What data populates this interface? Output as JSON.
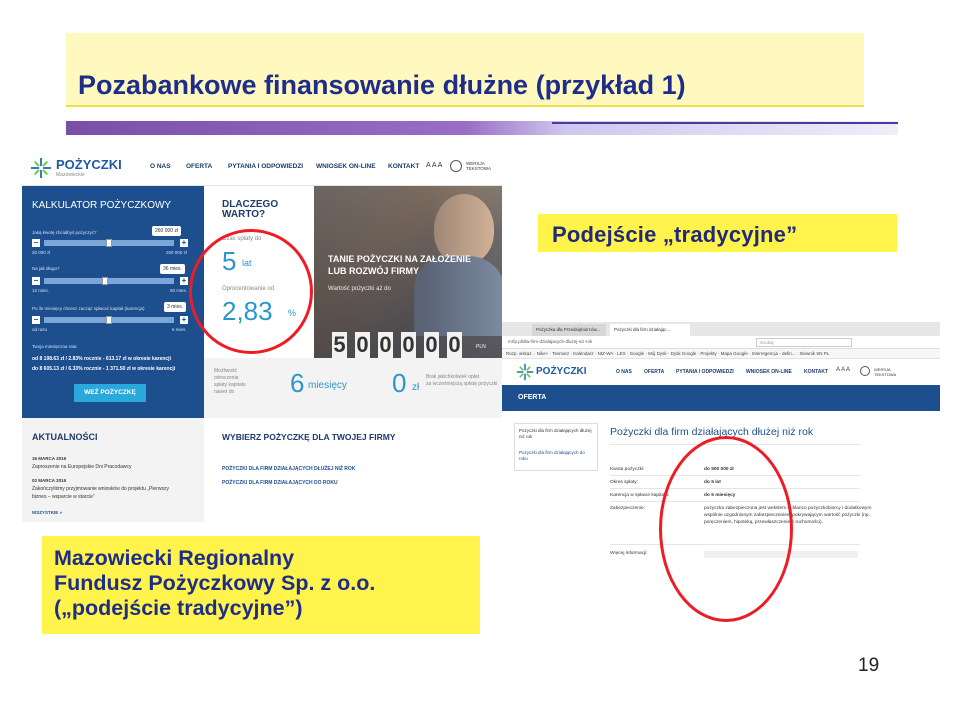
{
  "slide": {
    "title": "Pozabankowe finansowanie dłużne (przykład 1)",
    "label_traditional": "Podejście „tradycyjne”",
    "caption_line1": "Mazowiecki Regionalny",
    "caption_line2": "Fundusz Pożyczkowy Sp. z o.o.",
    "caption_line3": "(„podejście tradycyjne”)",
    "page_number": "19",
    "colors": {
      "title_bg": "#fff9bf",
      "highlight": "#fff34c",
      "text_blue": "#1f2d8a",
      "circle_red": "#ee1c24"
    }
  },
  "website": {
    "logo": "POŻYCZKI",
    "logo_sub": "Mazowieckie",
    "nav": [
      "O NAS",
      "OFERTA",
      "PYTANIA I ODPOWIEDZI",
      "WNIOSEK ON-LINE",
      "KONTAKT"
    ],
    "font_size_control": "A A A",
    "contrast_label": "WERSJA TEKSTOWA",
    "calculator": {
      "title": "KALKULATOR POŻYCZKOWY",
      "q1": "Jaką kwotę chciałbyś pożyczyć?",
      "q1_value": "260 000 zł",
      "q1_min": "20 000 zł",
      "q1_max": "200 000 zł",
      "q2": "Na jak długo?",
      "q2_value": "36 mies.",
      "q2_min": "12 mies.",
      "q2_max": "60 mies.",
      "q3": "Po ile miesięcy chcesz zacząć spłacać kapitał (karencja)",
      "q3_value": "3 mies.",
      "q3_min": "od razu",
      "q3_max": "6 mies.",
      "rate_label": "Twoja miesięczna rata",
      "rate1": "od 8 198.63 zł / 2.83% rocznie - 613.17 zł w okresie karencji",
      "rate2": "do 8 605.13 zł / 6.33% rocznie - 1 371.50 zł w okresie karencji",
      "button": "WEŹ POŻYCZKĘ"
    },
    "why": {
      "title_line1": "DLACZEGO",
      "title_line2": "WARTO?",
      "term_label": "Czas spłaty do",
      "term_value": "5",
      "term_unit": "lat",
      "rate_label": "Oprocentowanie od",
      "rate_value": "2,83",
      "rate_unit": "%"
    },
    "hero": {
      "title_line1": "TANIE POŻYCZKI NA ZAŁOŻENIE",
      "title_line2": "LUB ROZWÓJ FIRMY",
      "sub": "Wartość pożyczki aż do",
      "digits": [
        "5",
        "0",
        "0",
        "0",
        "0",
        "0"
      ],
      "currency": "PLN"
    },
    "benefits": {
      "grace_text_1": "Możliwość",
      "grace_text_2": "odroczenia",
      "grace_text_3": "spłaty kapitału",
      "grace_text_4": "nawet do",
      "grace_value": "6",
      "grace_unit": "miesięcy",
      "fee_value": "0",
      "fee_unit": "zł",
      "fee_text_1": "Brak jakichkolwiek opłat",
      "fee_text_2": "za wcześniejszą spłatę pożyczki"
    },
    "news": {
      "title": "AKTUALNOŚCI",
      "date1": "16 MARCA 2016",
      "text1": "Zaproszenie na Europejskie Dni Pracodawcy",
      "date2": "02 MARCA 2016",
      "text2a": "Zakończyliśmy przyjmowanie wniosków do projektu „Pierwszy",
      "text2b": "biznes – wsparcie w starcie”",
      "more": "WSZYSTKIE »"
    },
    "choose": {
      "title": "WYBIERZ POŻYCZKĘ DLA TWOJEJ FIRMY",
      "link1": "POŻYCZKI DLA FIRM DZIAŁAJĄCYCH DŁUŻEJ NIŻ ROK",
      "link2": "POŻYCZKI DLA FIRM DZIAŁAJĄCYCH DO ROKU"
    }
  },
  "browser": {
    "tabs": [
      "Pożyczka dla Przedsiębiorców...",
      "Pożyczki dla firm działając..."
    ],
    "url": "mrfp.pl/dla-firm-dzialajacych-dluzej-niz-rok",
    "search_placeholder": "Szukaj",
    "bookmarks": "Rozp. wskaz. · Nike+ · Tesmarz · Kalendarz · NIZ-WA · LEX · Google · Mój Dysk - Dysk Google · Projekty · Mapa Google · Interregencja - defin... · Słownik SN PL",
    "nav": [
      "O NAS",
      "OFERTA",
      "PYTANIA I ODPOWIEDZI",
      "WNIOSEK ON-LINE",
      "KONTAKT"
    ],
    "offer_bar": "OFERTA",
    "side_item1": "Pożyczki dla firm działających dłużej niż rok",
    "side_item2": "Pożyczki dla firm działających do roku",
    "page_title": "Pożyczki dla firm działających dłużej niż rok",
    "rows": [
      {
        "label": "Kwota pożyczki:",
        "value": "do 500 000 zł"
      },
      {
        "label": "Okres spłaty:",
        "value": "do 5 lat"
      },
      {
        "label": "Karencja w spłacie kapitału:",
        "value": "do 6 miesięcy"
      },
      {
        "label": "Zabezpieczenie:",
        "value": "pożyczka zabezpieczona jest wekslem in blanco pożyczkobiorcy i dodatkowym"
      },
      {
        "label": "",
        "value": "wspólnie uzgodnionym zabezpieczeniem pokrywającym wartość pożyczki (np."
      },
      {
        "label": "",
        "value": "poręczeniem, hipoteką, przewłaszczeniem ruchomości)."
      },
      {
        "label": "Więcej informacji:",
        "value": ""
      }
    ]
  }
}
